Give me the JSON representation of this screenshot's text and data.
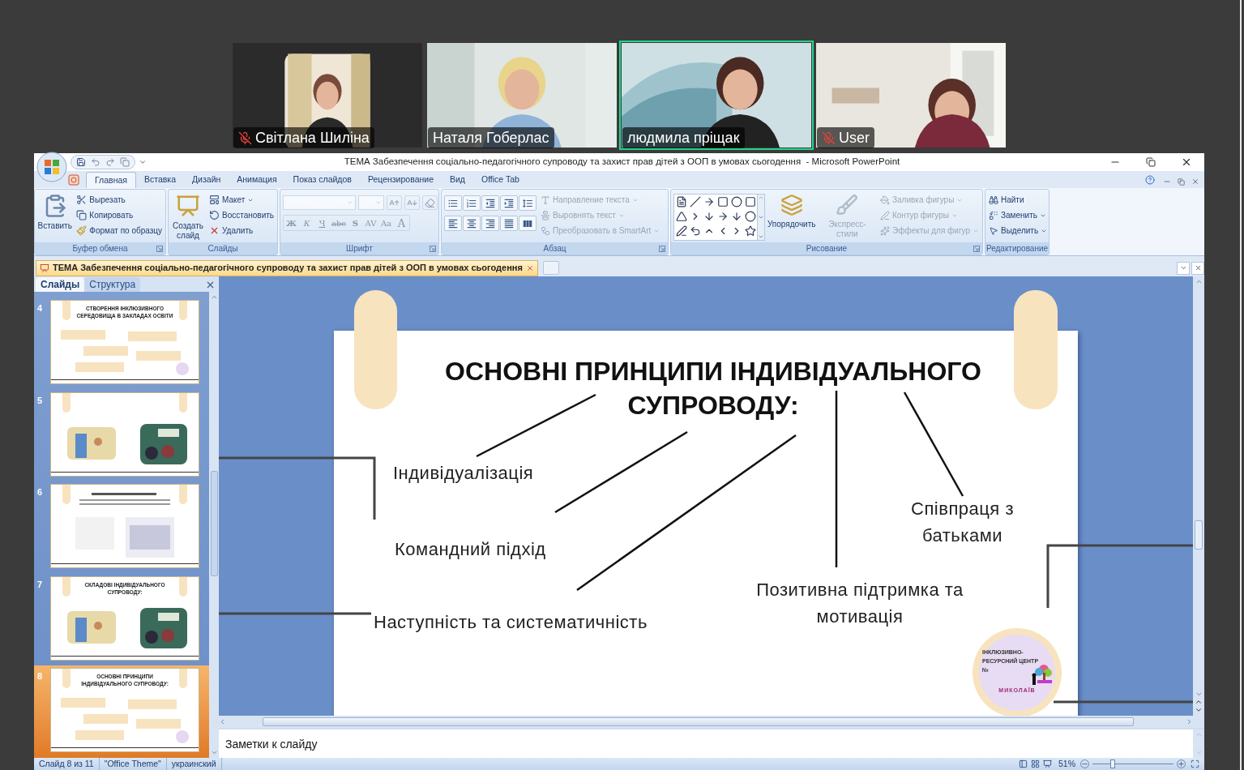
{
  "participants": [
    {
      "name": "Світлана Шиліна",
      "muted": true,
      "speaking": false
    },
    {
      "name": "Наталя Гоберлас",
      "muted": false,
      "speaking": false
    },
    {
      "name": "людмила пріщак",
      "muted": false,
      "speaking": true
    },
    {
      "name": "User",
      "muted": true,
      "speaking": false
    }
  ],
  "window": {
    "title": "ТЕМА Забезпечення соціально-педагогічного супроводу та захист прав дітей з ООП в умовах сьогодення  - Microsoft PowerPoint"
  },
  "ribbon": {
    "tabs": [
      {
        "label": "Главная",
        "selected": true
      },
      {
        "label": "Вставка",
        "selected": false
      },
      {
        "label": "Дизайн",
        "selected": false
      },
      {
        "label": "Анимация",
        "selected": false
      },
      {
        "label": "Показ слайдов",
        "selected": false
      },
      {
        "label": "Рецензирование",
        "selected": false
      },
      {
        "label": "Вид",
        "selected": false
      },
      {
        "label": "Office Tab",
        "selected": false
      }
    ],
    "groups": [
      {
        "kind": "clipboard",
        "label": "Буфер обмена",
        "large": [
          {
            "label": "Вставить",
            "disabled": false
          }
        ],
        "items": [
          {
            "label": "Вырезать",
            "disabled": false
          },
          {
            "label": "Копировать",
            "disabled": false
          },
          {
            "label": "Формат по образцу",
            "disabled": false
          }
        ]
      },
      {
        "kind": "slides",
        "label": "Слайды",
        "large": [
          {
            "label": "Создать слайд",
            "disabled": false
          }
        ],
        "items": [
          {
            "label": "Макет",
            "disabled": false
          },
          {
            "label": "Восстановить",
            "disabled": false
          },
          {
            "label": "Удалить",
            "disabled": false
          }
        ]
      },
      {
        "kind": "font",
        "label": "Шрифт",
        "disabled": true,
        "format_buttons": [
          "Ж",
          "К",
          "Ч",
          "abc",
          "S",
          "AV",
          "Aa",
          "A"
        ]
      },
      {
        "kind": "paragraph",
        "label": "Абзац",
        "items": [
          {
            "label": "Направление текста",
            "disabled": true
          },
          {
            "label": "Выровнять текст",
            "disabled": true
          },
          {
            "label": "Преобразовать в SmartArt",
            "disabled": true
          }
        ]
      },
      {
        "kind": "drawing",
        "label": "Рисование",
        "large": [
          {
            "label": "Упорядочить",
            "disabled": false
          },
          {
            "label": "Экспресс-стили",
            "disabled": true
          }
        ],
        "items": [
          {
            "label": "Заливка фигуры",
            "disabled": true
          },
          {
            "label": "Контур фигуры",
            "disabled": true
          },
          {
            "label": "Эффекты для фигур",
            "disabled": true
          }
        ]
      },
      {
        "kind": "editing",
        "label": "Редактирование",
        "items": [
          {
            "label": "Найти",
            "disabled": false
          },
          {
            "label": "Заменить",
            "disabled": false
          },
          {
            "label": "Выделить",
            "disabled": false
          }
        ]
      }
    ]
  },
  "document_tab": {
    "title": "ТЕМА Забезпечення соціально-педагогічного супроводу та захист прав дітей з ООП в умовах сьогодення"
  },
  "slides_pane": {
    "tabs": [
      {
        "label": "Слайды",
        "selected": true
      },
      {
        "label": "Структура",
        "selected": false
      }
    ],
    "slides": [
      {
        "number": "4",
        "kind": "text",
        "title": "СТВОРЕННЯ ІНКЛЮЗИВНОГО СЕРЕДОВИЩА В ЗАКЛАДАХ ОСВІТИ",
        "selected": false
      },
      {
        "number": "5",
        "kind": "picture",
        "selected": false
      },
      {
        "number": "6",
        "kind": "document",
        "selected": false
      },
      {
        "number": "7",
        "kind": "picture",
        "title": "СКЛАДОВІ ІНДИВІДУАЛЬНОГО СУПРОВОДУ:",
        "selected": false
      },
      {
        "number": "8",
        "kind": "text",
        "title": "ОСНОВНІ ПРИНЦИПИ ІНДИВІДУАЛЬНОГО СУПРОВОДУ:",
        "selected": true
      }
    ]
  },
  "slide": {
    "title": "ОСНОВНІ ПРИНЦИПИ ІНДИВІДУАЛЬНОГО СУПРОВОДУ:",
    "principles": [
      "Індивідуалізація",
      "Командний підхід",
      "Наступність та систематичність",
      "Позитивна підтримка та мотивація",
      "Співпраця з батьками"
    ],
    "logo": {
      "lines": [
        "ІНКЛЮЗИВНО-",
        "РЕСУРСНИЙ ЦЕНТР",
        "№"
      ],
      "city": "МИКОЛАЇВ"
    }
  },
  "notes": {
    "placeholder": "Заметки к слайду"
  },
  "status_bar": {
    "slide": "Слайд 8 из 11",
    "theme": "\"Office Theme\"",
    "language": "украинский",
    "zoom": "51%",
    "level": 0.25
  }
}
